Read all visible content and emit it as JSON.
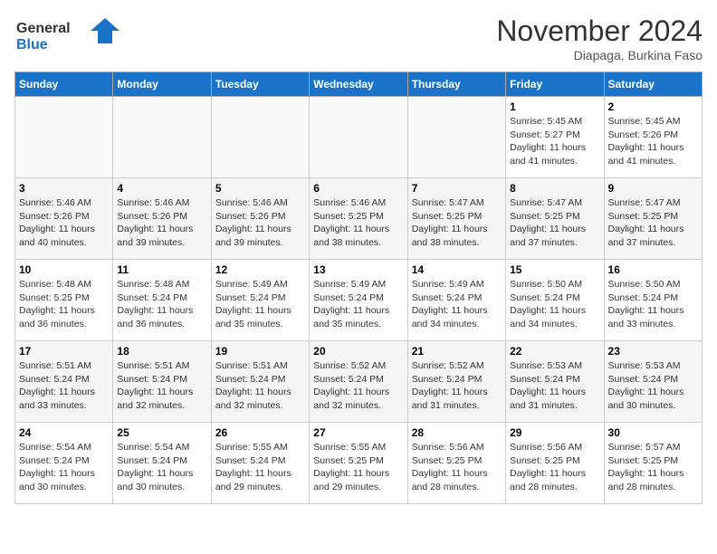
{
  "header": {
    "logo_line1": "General",
    "logo_line2": "Blue",
    "month_title": "November 2024",
    "location": "Diapaga, Burkina Faso"
  },
  "weekdays": [
    "Sunday",
    "Monday",
    "Tuesday",
    "Wednesday",
    "Thursday",
    "Friday",
    "Saturday"
  ],
  "weeks": [
    [
      {
        "day": "",
        "info": ""
      },
      {
        "day": "",
        "info": ""
      },
      {
        "day": "",
        "info": ""
      },
      {
        "day": "",
        "info": ""
      },
      {
        "day": "",
        "info": ""
      },
      {
        "day": "1",
        "info": "Sunrise: 5:45 AM\nSunset: 5:27 PM\nDaylight: 11 hours\nand 41 minutes."
      },
      {
        "day": "2",
        "info": "Sunrise: 5:45 AM\nSunset: 5:26 PM\nDaylight: 11 hours\nand 41 minutes."
      }
    ],
    [
      {
        "day": "3",
        "info": "Sunrise: 5:46 AM\nSunset: 5:26 PM\nDaylight: 11 hours\nand 40 minutes."
      },
      {
        "day": "4",
        "info": "Sunrise: 5:46 AM\nSunset: 5:26 PM\nDaylight: 11 hours\nand 39 minutes."
      },
      {
        "day": "5",
        "info": "Sunrise: 5:46 AM\nSunset: 5:26 PM\nDaylight: 11 hours\nand 39 minutes."
      },
      {
        "day": "6",
        "info": "Sunrise: 5:46 AM\nSunset: 5:25 PM\nDaylight: 11 hours\nand 38 minutes."
      },
      {
        "day": "7",
        "info": "Sunrise: 5:47 AM\nSunset: 5:25 PM\nDaylight: 11 hours\nand 38 minutes."
      },
      {
        "day": "8",
        "info": "Sunrise: 5:47 AM\nSunset: 5:25 PM\nDaylight: 11 hours\nand 37 minutes."
      },
      {
        "day": "9",
        "info": "Sunrise: 5:47 AM\nSunset: 5:25 PM\nDaylight: 11 hours\nand 37 minutes."
      }
    ],
    [
      {
        "day": "10",
        "info": "Sunrise: 5:48 AM\nSunset: 5:25 PM\nDaylight: 11 hours\nand 36 minutes."
      },
      {
        "day": "11",
        "info": "Sunrise: 5:48 AM\nSunset: 5:24 PM\nDaylight: 11 hours\nand 36 minutes."
      },
      {
        "day": "12",
        "info": "Sunrise: 5:49 AM\nSunset: 5:24 PM\nDaylight: 11 hours\nand 35 minutes."
      },
      {
        "day": "13",
        "info": "Sunrise: 5:49 AM\nSunset: 5:24 PM\nDaylight: 11 hours\nand 35 minutes."
      },
      {
        "day": "14",
        "info": "Sunrise: 5:49 AM\nSunset: 5:24 PM\nDaylight: 11 hours\nand 34 minutes."
      },
      {
        "day": "15",
        "info": "Sunrise: 5:50 AM\nSunset: 5:24 PM\nDaylight: 11 hours\nand 34 minutes."
      },
      {
        "day": "16",
        "info": "Sunrise: 5:50 AM\nSunset: 5:24 PM\nDaylight: 11 hours\nand 33 minutes."
      }
    ],
    [
      {
        "day": "17",
        "info": "Sunrise: 5:51 AM\nSunset: 5:24 PM\nDaylight: 11 hours\nand 33 minutes."
      },
      {
        "day": "18",
        "info": "Sunrise: 5:51 AM\nSunset: 5:24 PM\nDaylight: 11 hours\nand 32 minutes."
      },
      {
        "day": "19",
        "info": "Sunrise: 5:51 AM\nSunset: 5:24 PM\nDaylight: 11 hours\nand 32 minutes."
      },
      {
        "day": "20",
        "info": "Sunrise: 5:52 AM\nSunset: 5:24 PM\nDaylight: 11 hours\nand 32 minutes."
      },
      {
        "day": "21",
        "info": "Sunrise: 5:52 AM\nSunset: 5:24 PM\nDaylight: 11 hours\nand 31 minutes."
      },
      {
        "day": "22",
        "info": "Sunrise: 5:53 AM\nSunset: 5:24 PM\nDaylight: 11 hours\nand 31 minutes."
      },
      {
        "day": "23",
        "info": "Sunrise: 5:53 AM\nSunset: 5:24 PM\nDaylight: 11 hours\nand 30 minutes."
      }
    ],
    [
      {
        "day": "24",
        "info": "Sunrise: 5:54 AM\nSunset: 5:24 PM\nDaylight: 11 hours\nand 30 minutes."
      },
      {
        "day": "25",
        "info": "Sunrise: 5:54 AM\nSunset: 5:24 PM\nDaylight: 11 hours\nand 30 minutes."
      },
      {
        "day": "26",
        "info": "Sunrise: 5:55 AM\nSunset: 5:24 PM\nDaylight: 11 hours\nand 29 minutes."
      },
      {
        "day": "27",
        "info": "Sunrise: 5:55 AM\nSunset: 5:25 PM\nDaylight: 11 hours\nand 29 minutes."
      },
      {
        "day": "28",
        "info": "Sunrise: 5:56 AM\nSunset: 5:25 PM\nDaylight: 11 hours\nand 28 minutes."
      },
      {
        "day": "29",
        "info": "Sunrise: 5:56 AM\nSunset: 5:25 PM\nDaylight: 11 hours\nand 28 minutes."
      },
      {
        "day": "30",
        "info": "Sunrise: 5:57 AM\nSunset: 5:25 PM\nDaylight: 11 hours\nand 28 minutes."
      }
    ]
  ]
}
